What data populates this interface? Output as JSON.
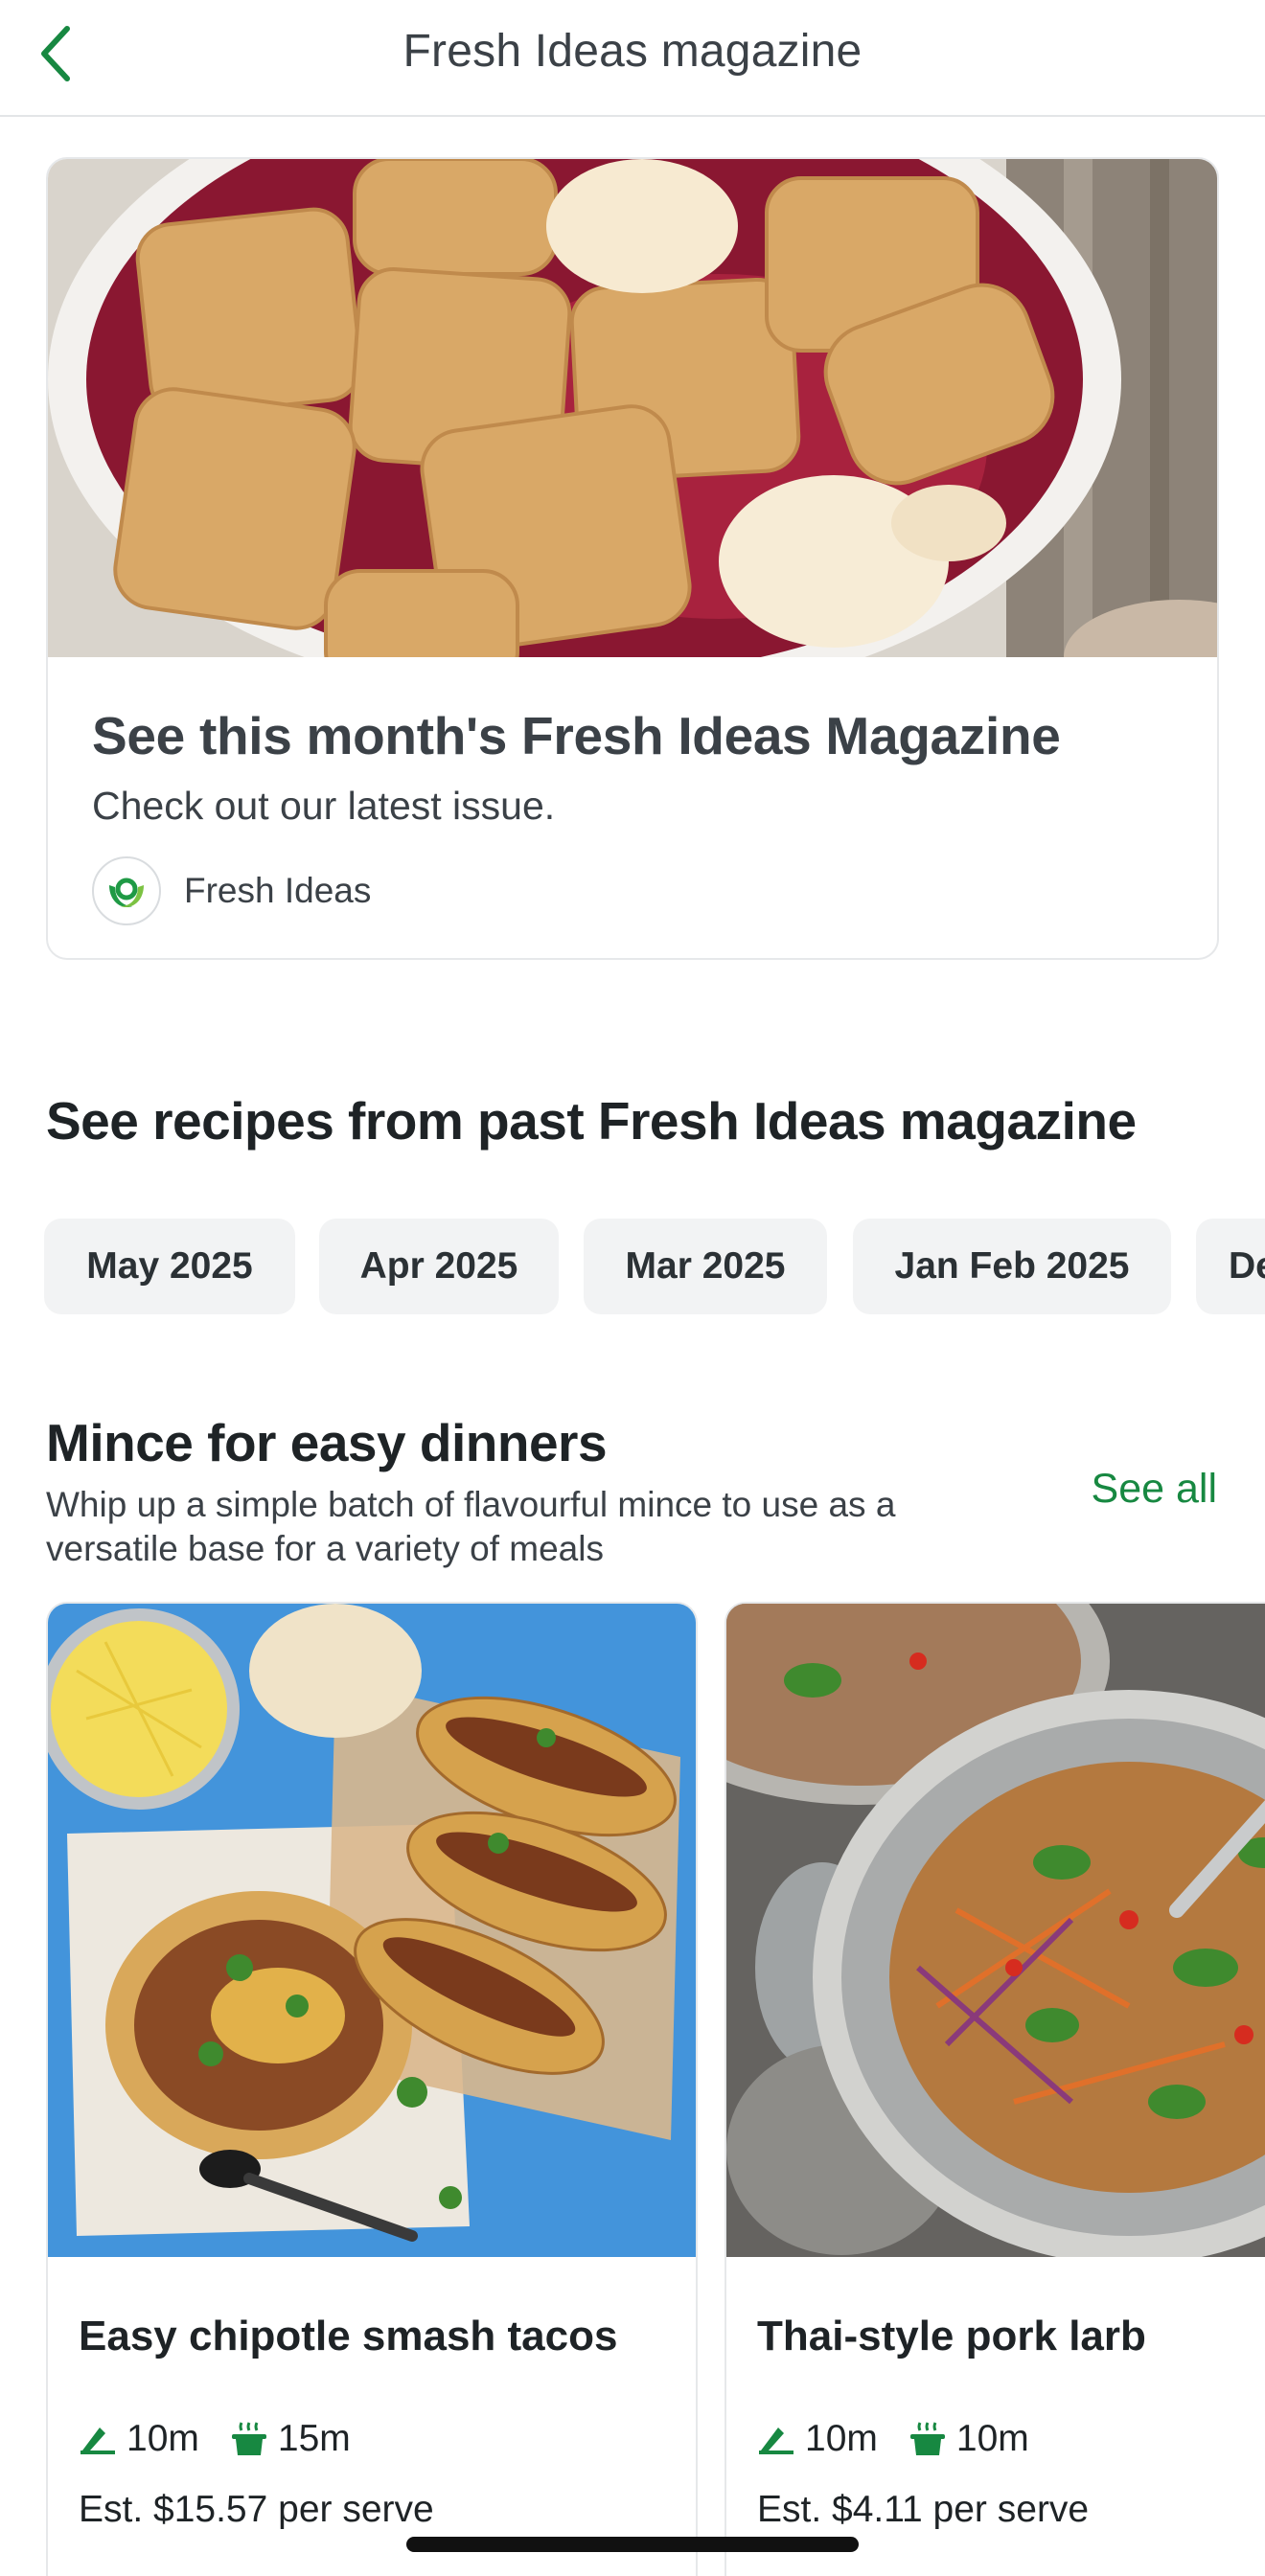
{
  "header": {
    "title": "Fresh Ideas magazine"
  },
  "magazine": {
    "title": "See this month's Fresh Ideas Magazine",
    "subtitle": "Check out our latest issue.",
    "source": "Fresh Ideas"
  },
  "past_issues": {
    "title": "See recipes from past Fresh Ideas magazine",
    "chips": [
      "May 2025",
      "Apr 2025",
      "Mar 2025",
      "Jan Feb 2025",
      "De"
    ]
  },
  "mince_section": {
    "title": "Mince for easy dinners",
    "description": "Whip up a simple batch of flavourful mince to use as a versatile base for a variety of meals",
    "see_all": "See all"
  },
  "recipes": [
    {
      "title": "Easy chipotle smash tacos",
      "prep": "10m",
      "cook": "15m",
      "price": "Est. $15.57 per serve"
    },
    {
      "title": "Thai-style pork larb",
      "prep": "10m",
      "cook": "10m",
      "price": "Est. $4.11 per serve"
    }
  ],
  "colors": {
    "accent_green": "#178841",
    "chip_bg": "#f2f3f4",
    "text_dark": "#1e2326"
  }
}
